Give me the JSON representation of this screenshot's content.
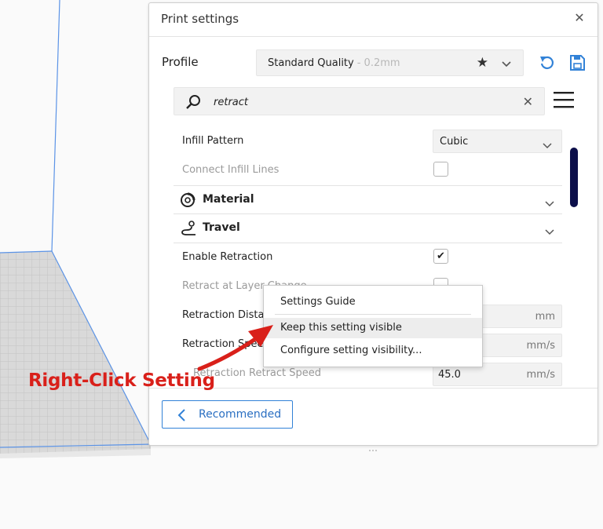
{
  "panel": {
    "title": "Print settings",
    "close_glyph": "✕"
  },
  "profile": {
    "label": "Profile",
    "name": "Standard Quality",
    "layer_height": "- 0.2mm",
    "favorite_glyph": "★"
  },
  "search": {
    "value": "retract",
    "clear_glyph": "✕"
  },
  "settings": {
    "infill_pattern": {
      "label": "Infill Pattern",
      "value": "Cubic"
    },
    "connect_infill_lines": {
      "label": "Connect Infill Lines",
      "checked": false
    },
    "material": {
      "label": "Material"
    },
    "travel": {
      "label": "Travel"
    },
    "enable_retraction": {
      "label": "Enable Retraction",
      "check_glyph": "✔"
    },
    "retract_layer_change": {
      "label": "Retract at Layer Change"
    },
    "retraction_distance": {
      "label": "Retraction Distance",
      "unit": "mm"
    },
    "retraction_speed": {
      "label": "Retraction Speed",
      "unit": "mm/s"
    },
    "retraction_retract_speed": {
      "label": "Retraction Retract Speed",
      "value": "45.0",
      "unit": "mm/s"
    }
  },
  "context_menu": {
    "items": [
      "Settings Guide",
      "Keep this setting visible",
      "Configure setting visibility..."
    ]
  },
  "footer": {
    "recommended_label": "Recommended"
  },
  "annotation": {
    "text": "Right-Click Setting",
    "color": "#d9201a"
  },
  "colors": {
    "accent_blue": "#3282d7",
    "scrollbar": "#0c0f4a"
  },
  "icons": {
    "search": "magnifier-icon",
    "menu": "hamburger-icon",
    "reset": "undo-icon",
    "save": "floppy-icon",
    "material": "spool-icon",
    "travel": "travel-path-icon"
  }
}
